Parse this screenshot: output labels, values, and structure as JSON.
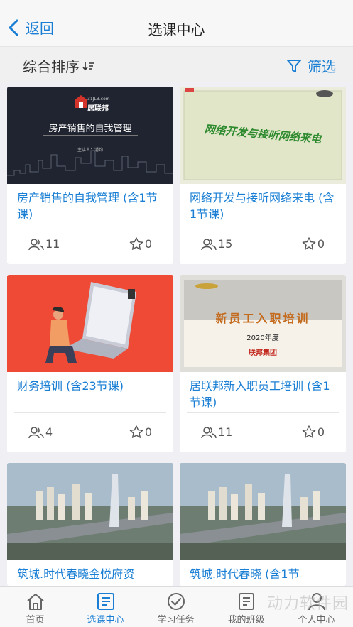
{
  "header": {
    "back_label": "返回",
    "title": "选课中心"
  },
  "toolbar": {
    "sort_label": "综合排序",
    "filter_label": "筛选"
  },
  "courses": [
    {
      "title": "房产销售的自我管理 (含1节课)",
      "students": "11",
      "favorites": "0",
      "thumb": {
        "logo_domain": "31JLB.com",
        "logo_text": "居联邦",
        "headline": "房产销售的自我管理",
        "speaker": "主讲人：潘均"
      }
    },
    {
      "title": "网络开发与接听网络来电 (含1节课)",
      "students": "15",
      "favorites": "0",
      "thumb": {
        "headline": "网络开发与接听网络来电"
      }
    },
    {
      "title": "财务培训 (含23节课)",
      "students": "4",
      "favorites": "0"
    },
    {
      "title": "居联邦新入职员工培训 (含1节课)",
      "students": "11",
      "favorites": "0",
      "thumb": {
        "headline": "新员工入职培训",
        "year": "2020年度",
        "company": "联邦集团"
      }
    },
    {
      "title": "筑城.时代春晓金悦府资",
      "students": "",
      "favorites": ""
    },
    {
      "title": "筑城.时代春晓 (含1节",
      "students": "",
      "favorites": ""
    }
  ],
  "tabbar": [
    {
      "label": "首页",
      "icon": "home-icon"
    },
    {
      "label": "选课中心",
      "icon": "course-list-icon",
      "active": true
    },
    {
      "label": "学习任务",
      "icon": "check-circle-icon"
    },
    {
      "label": "我的班级",
      "icon": "class-icon"
    },
    {
      "label": "个人中心",
      "icon": "user-icon"
    }
  ],
  "watermark": "动力软件园",
  "colors": {
    "accent": "#1a7fd4",
    "background": "#efeff4"
  }
}
